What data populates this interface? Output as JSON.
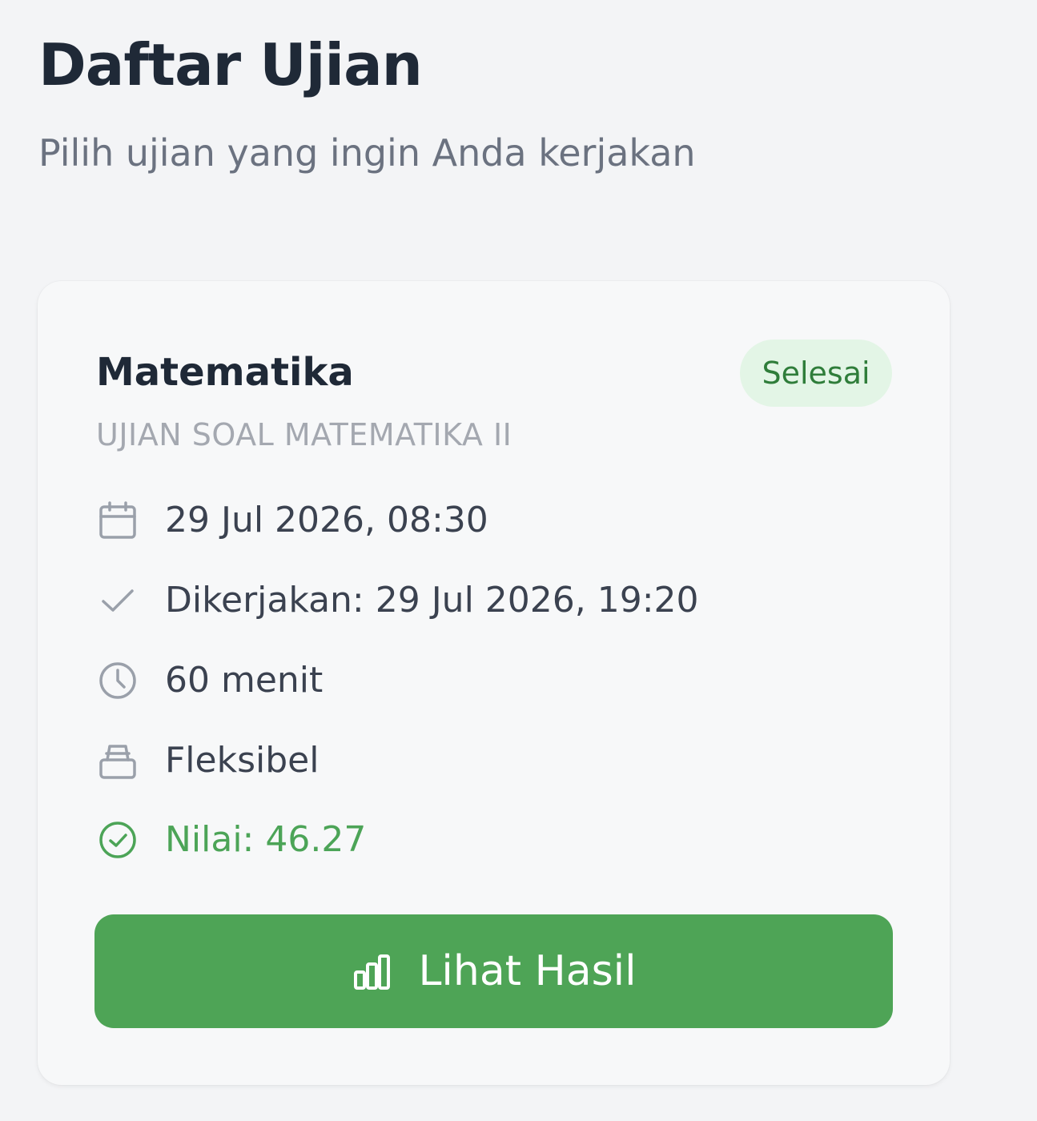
{
  "header": {
    "title": "Daftar Ujian",
    "subtitle": "Pilih ujian yang ingin Anda kerjakan"
  },
  "exam_card": {
    "title": "Matematika",
    "status": "Selesai",
    "subtitle": "UJIAN SOAL MATEMATIKA II",
    "schedule": "29 Jul 2026, 08:30",
    "completed_at": "Dikerjakan: 29 Jul 2026, 19:20",
    "duration": "60 menit",
    "mode": "Fleksibel",
    "score": "Nilai: 46.27",
    "button_label": "Lihat Hasil",
    "icons": {
      "schedule": "calendar-icon",
      "completed_at": "check-icon",
      "duration": "clock-icon",
      "mode": "tray-icon",
      "score": "check-circle-icon",
      "button": "bar-chart-icon"
    }
  },
  "colors": {
    "background": "#f3f4f6",
    "card": "#f7f8f9",
    "accent_green": "#4ea456",
    "badge_bg": "#e3f5e6",
    "badge_text": "#2f7d3a"
  }
}
